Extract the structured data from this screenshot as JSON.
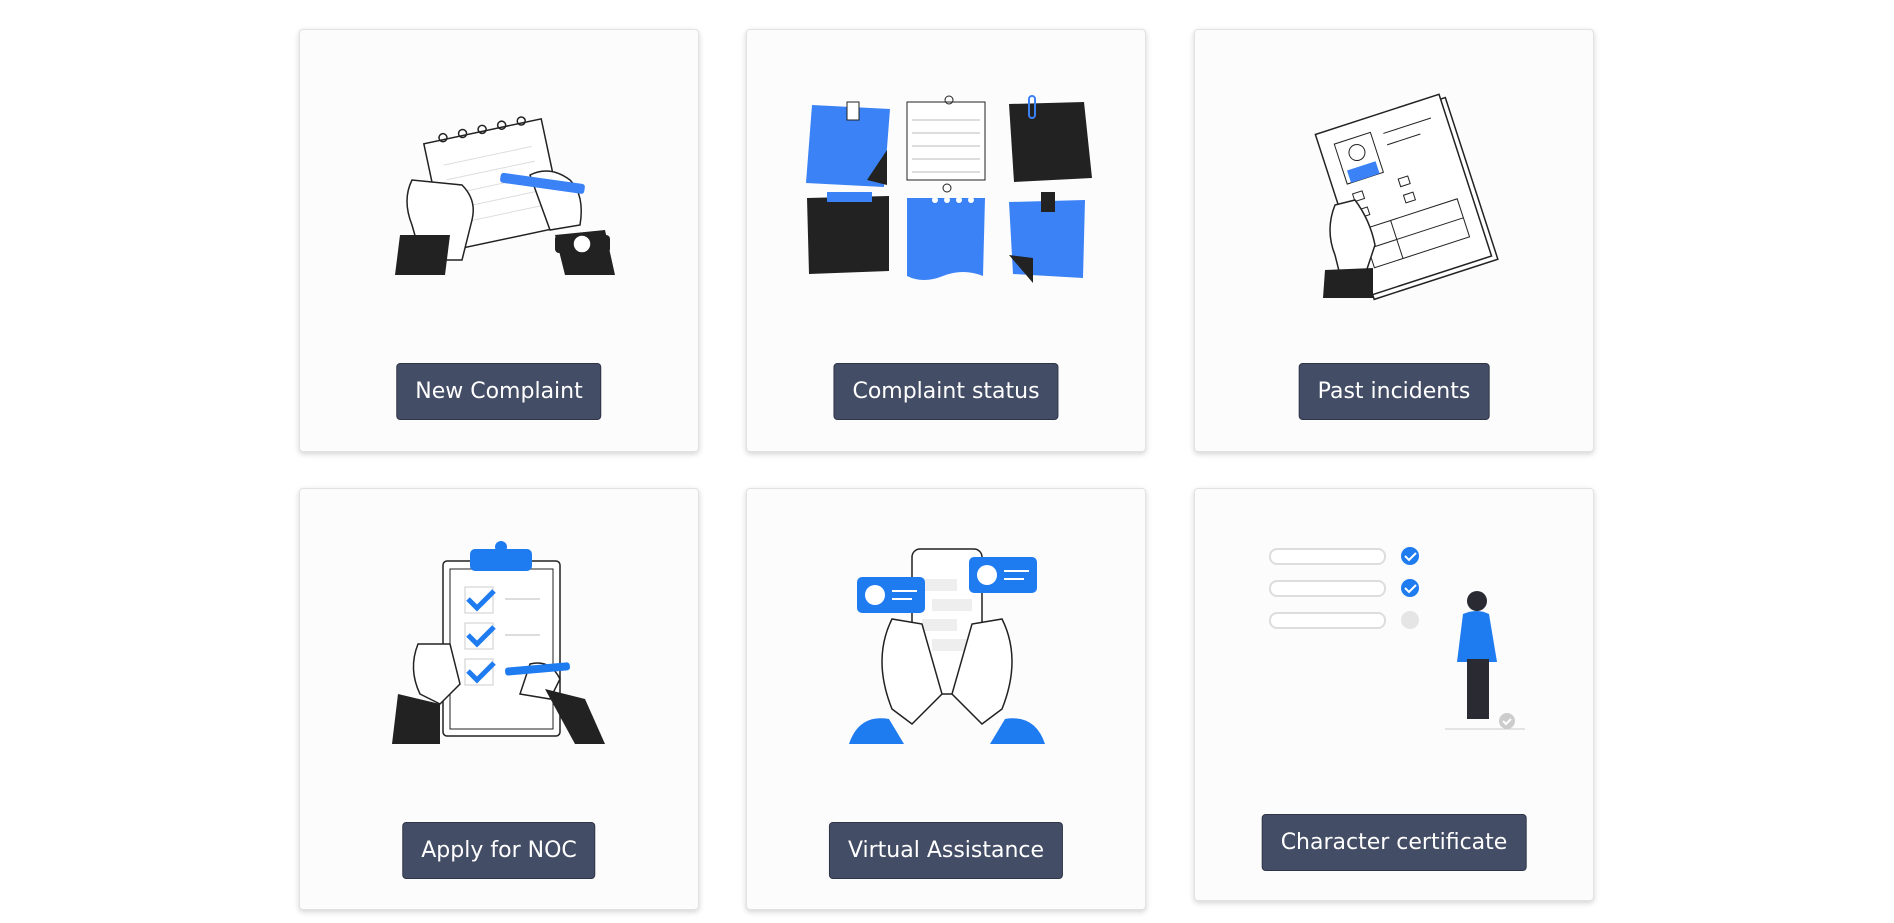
{
  "colors": {
    "accent_blue": "#3b82f6",
    "dark_ink": "#222222",
    "button_bg": "#444d66",
    "card_bg": "#fcfcfd"
  },
  "cards": [
    {
      "label": "New Complaint",
      "icon": "writing-notepad-illustration"
    },
    {
      "label": "Complaint status",
      "icon": "sticky-notes-illustration"
    },
    {
      "label": "Past incidents",
      "icon": "record-file-illustration"
    },
    {
      "label": "Apply for NOC",
      "icon": "checklist-clipboard-illustration"
    },
    {
      "label": "Virtual Assistance",
      "icon": "phone-chat-illustration"
    },
    {
      "label": "Character certificate",
      "icon": "person-checklist-illustration"
    }
  ]
}
